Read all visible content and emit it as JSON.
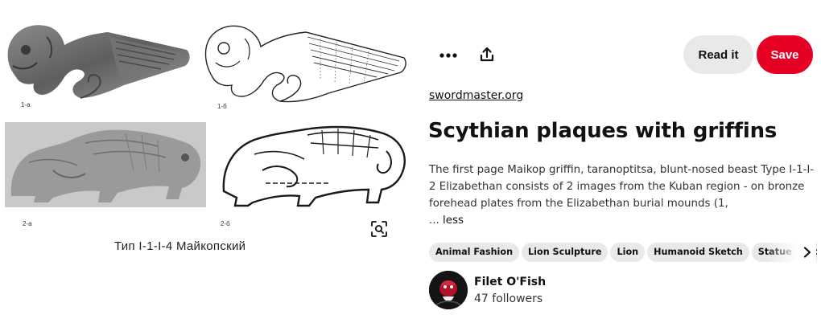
{
  "image": {
    "plate_labels": [
      "1-a",
      "1-б",
      "2-a",
      "2-б"
    ],
    "caption": "Тип I-1-I-4  Майкопский",
    "visual_search_icon": "lens-search-icon"
  },
  "actions": {
    "more_icon": "ellipsis-icon",
    "share_icon": "share-upload-icon",
    "read_label": "Read it",
    "save_label": "Save"
  },
  "pin": {
    "source": "swordmaster.org",
    "title": "Scythian plaques with griffins",
    "description": "The first page Maikop griffin, taranoptitsa, blunt-nosed beast Type I-1-I-2 Elizabethan consists of 2 images from the Kuban region - on bronze forehead plates from the Elizabethan burial mounds (1,",
    "ellipsis": "...",
    "less_label": "less"
  },
  "tags": [
    "Animal Fashion",
    "Lion Sculpture",
    "Lion",
    "Humanoid Sketch",
    "Statue",
    "Sculpture"
  ],
  "tags_next_icon": "chevron-right-icon",
  "author": {
    "name": "Filet O'Fish",
    "followers": "47 followers"
  },
  "colors": {
    "save": "#e60023",
    "chip": "#e9e9e9"
  }
}
